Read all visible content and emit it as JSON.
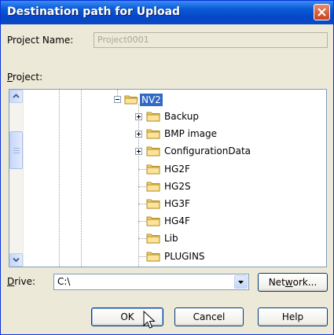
{
  "dialog": {
    "title": "Destination path for Upload"
  },
  "project_name": {
    "label": "Project Name:",
    "value": "Project0001"
  },
  "project": {
    "label_prefix": "",
    "label_hotkey": "P",
    "label_rest": "roject:"
  },
  "tree": {
    "root": "NV2",
    "items": [
      {
        "label": "Backup",
        "expandable": true
      },
      {
        "label": "BMP image",
        "expandable": true
      },
      {
        "label": "ConfigurationData",
        "expandable": true
      },
      {
        "label": "HG2F",
        "expandable": false
      },
      {
        "label": "HG2S",
        "expandable": false
      },
      {
        "label": "HG3F",
        "expandable": false
      },
      {
        "label": "HG4F",
        "expandable": false
      },
      {
        "label": "Lib",
        "expandable": false
      },
      {
        "label": "PLUGINS",
        "expandable": false
      }
    ]
  },
  "drive": {
    "label_hotkey": "D",
    "label_rest": "rive:",
    "value": "C:\\"
  },
  "buttons": {
    "network_pre": "Net",
    "network_hotkey": "w",
    "network_post": "ork...",
    "ok": "OK",
    "cancel": "Cancel",
    "help": "Help"
  },
  "colors": {
    "selection": "#316ac5",
    "titlebar": "#0a5bd6",
    "dialog_bg": "#ece9d8"
  }
}
